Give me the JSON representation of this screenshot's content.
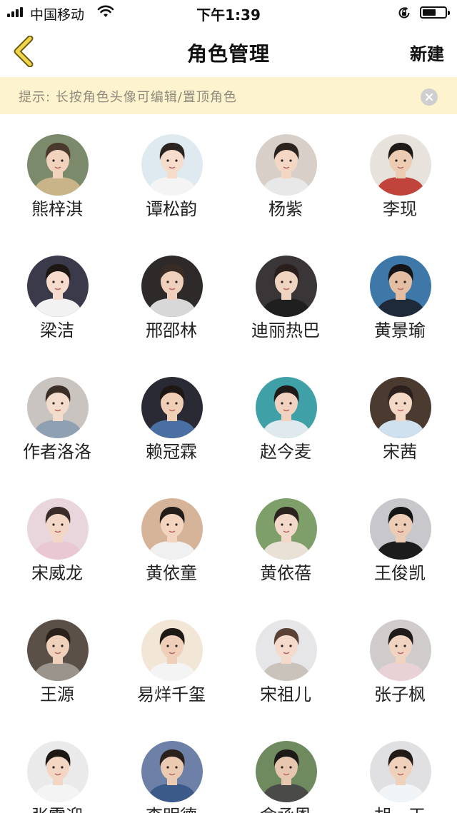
{
  "status_bar": {
    "carrier": "中国移动",
    "time": "下午1:39"
  },
  "nav": {
    "title": "角色管理",
    "new_label": "新建"
  },
  "tip": {
    "text": "提示: 长按角色头像可编辑/置顶角色"
  },
  "characters": [
    {
      "name": "熊梓淇",
      "bg": "#7a8a6a",
      "skin": "#f1d2bd",
      "hair": "#4a3a2e",
      "shirt": "#c9b48a"
    },
    {
      "name": "谭松韵",
      "bg": "#dfe9f0",
      "skin": "#f6dccb",
      "hair": "#2b2320",
      "shirt": "#f4f4f4"
    },
    {
      "name": "杨紫",
      "bg": "#d8d0c8",
      "skin": "#f3d6c4",
      "hair": "#2c221d",
      "shirt": "#e8e8e8"
    },
    {
      "name": "李现",
      "bg": "#e8e2dc",
      "skin": "#ecccb3",
      "hair": "#1f1a17",
      "shirt": "#c0443c"
    },
    {
      "name": "梁洁",
      "bg": "#3a3a4a",
      "skin": "#f5dccd",
      "hair": "#1d1714",
      "shirt": "#f2f2f2"
    },
    {
      "name": "邢邵林",
      "bg": "#2f2a2a",
      "skin": "#efd0bc",
      "hair": "#3a2c24",
      "shirt": "#d8d8d8"
    },
    {
      "name": "迪丽热巴",
      "bg": "#3a3536",
      "skin": "#f0d4c2",
      "hair": "#2a1f1c",
      "shirt": "#1f1f1f"
    },
    {
      "name": "黄景瑜",
      "bg": "#3e78a8",
      "skin": "#e3bea2",
      "hair": "#151515",
      "shirt": "#1e2a3a"
    },
    {
      "name": "作者洛洛",
      "bg": "#c9c4c0",
      "skin": "#f4dccd",
      "hair": "#3a2e27",
      "shirt": "#8fa0b2"
    },
    {
      "name": "赖冠霖",
      "bg": "#2a2a35",
      "skin": "#efcfb6",
      "hair": "#1d1814",
      "shirt": "#4a6fa3"
    },
    {
      "name": "赵今麦",
      "bg": "#3fa0a8",
      "skin": "#f1d2c0",
      "hair": "#1f1a18",
      "shirt": "#dfe9ee"
    },
    {
      "name": "宋茜",
      "bg": "#4a3a30",
      "skin": "#f4d8c6",
      "hair": "#2b201b",
      "shirt": "#cfe0ee"
    },
    {
      "name": "宋威龙",
      "bg": "#e8d6dc",
      "skin": "#f2d6c6",
      "hair": "#3a2c28",
      "shirt": "#e9c8d4"
    },
    {
      "name": "黄依童",
      "bg": "#d6b49a",
      "skin": "#f3d4bf",
      "hair": "#231c18",
      "shirt": "#f0f0f0"
    },
    {
      "name": "黄依蓓",
      "bg": "#7e9e6a",
      "skin": "#f3d9c9",
      "hair": "#2c221e",
      "shirt": "#e9e0d6"
    },
    {
      "name": "王俊凯",
      "bg": "#c8c8cc",
      "skin": "#ecccb5",
      "hair": "#141414",
      "shirt": "#1c1c1c"
    },
    {
      "name": "王源",
      "bg": "#5b5048",
      "skin": "#efd0bb",
      "hair": "#2a211c",
      "shirt": "#9a948c"
    },
    {
      "name": "易烊千玺",
      "bg": "#f2e6d6",
      "skin": "#efcfb9",
      "hair": "#1f1915",
      "shirt": "#f4f4f4"
    },
    {
      "name": "宋祖儿",
      "bg": "#e6e6e8",
      "skin": "#f4dacb",
      "hair": "#5a4336",
      "shirt": "#c9c3bc"
    },
    {
      "name": "张子枫",
      "bg": "#d0cccc",
      "skin": "#f1d3c2",
      "hair": "#201a18",
      "shirt": "#e9d2d6"
    },
    {
      "name": "张雪迎",
      "bg": "#eaeaea",
      "skin": "#f2d5c3",
      "hair": "#1e1815",
      "shirt": "#f4f4f4"
    },
    {
      "name": "李明德",
      "bg": "#6c80a8",
      "skin": "#ebcab2",
      "hair": "#2a211d",
      "shirt": "#3b5a8a"
    },
    {
      "name": "俞承恩",
      "bg": "#6e8a5e",
      "skin": "#e6c6ae",
      "hair": "#1d1916",
      "shirt": "#4a4a48"
    },
    {
      "name": "胡一天",
      "bg": "#e0e0e2",
      "skin": "#efd0bb",
      "hair": "#221b18",
      "shirt": "#f0f4f6"
    }
  ]
}
